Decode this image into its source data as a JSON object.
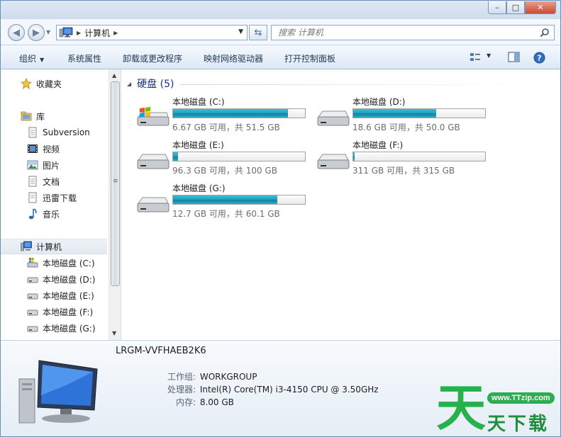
{
  "window": {
    "minimize": "–",
    "maximize": "□",
    "close": "✕"
  },
  "address": {
    "breadcrumb": "计算机"
  },
  "search": {
    "placeholder": "搜索 计算机"
  },
  "toolbar": {
    "organize": "组织",
    "system_properties": "系统属性",
    "uninstall": "卸载或更改程序",
    "map_drive": "映射网络驱动器",
    "control_panel": "打开控制面板"
  },
  "sidebar": {
    "favorites": "收藏夹",
    "libraries": "库",
    "library_items": [
      "Subversion",
      "视频",
      "图片",
      "文档",
      "迅雷下载",
      "音乐"
    ],
    "computer": "计算机",
    "drives": [
      "本地磁盘 (C:)",
      "本地磁盘 (D:)",
      "本地磁盘 (E:)",
      "本地磁盘 (F:)",
      "本地磁盘 (G:)"
    ]
  },
  "content": {
    "group_title": "硬盘 (5)",
    "drives": [
      {
        "name": "本地磁盘 (C:)",
        "info": "6.67 GB 可用，共 51.5 GB",
        "used_fraction": 0.87,
        "system": true
      },
      {
        "name": "本地磁盘 (D:)",
        "info": "18.6 GB 可用，共 50.0 GB",
        "used_fraction": 0.63,
        "system": false
      },
      {
        "name": "本地磁盘 (E:)",
        "info": "96.3 GB 可用，共 100 GB",
        "used_fraction": 0.04,
        "system": false
      },
      {
        "name": "本地磁盘 (F:)",
        "info": "311 GB 可用，共 315 GB",
        "used_fraction": 0.01,
        "system": false
      },
      {
        "name": "本地磁盘 (G:)",
        "info": "12.7 GB 可用，共 60.1 GB",
        "used_fraction": 0.79,
        "system": false
      }
    ]
  },
  "details": {
    "computer_name": "LRGM-VVFHAEB2K6",
    "workgroup_label": "工作组:",
    "workgroup_value": "WORKGROUP",
    "cpu_label": "处理器:",
    "cpu_value": "Intel(R) Core(TM) i3-4150 CPU @ 3.50GHz",
    "memory_label": "内存:",
    "memory_value": "8.00 GB"
  },
  "watermark": {
    "logo_char": "天",
    "url": "www.TTzip.com",
    "text": "天下载"
  },
  "colors": {
    "accent": "#1e3287",
    "bar_fill": "#1fa4c4",
    "watermark_green": "#25b24a"
  }
}
